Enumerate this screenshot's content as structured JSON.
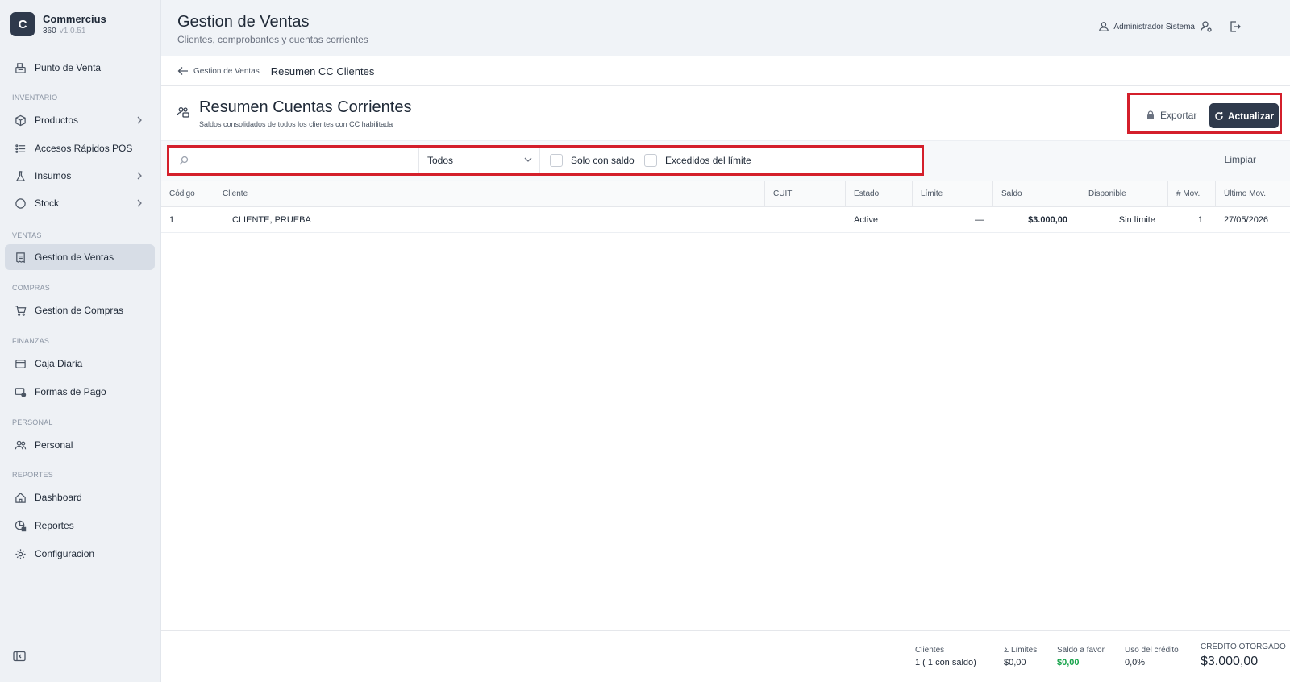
{
  "brand": {
    "logo_letter": "C",
    "name": "Commercius",
    "sub": "360",
    "version": "v1.0.51"
  },
  "sidebar": {
    "pos": "Punto de Venta",
    "sections": {
      "inventario": "INVENTARIO",
      "ventas": "VENTAS",
      "compras": "COMPRAS",
      "finanzas": "FINANZAS",
      "personal": "PERSONAL",
      "reportes": "REPORTES"
    },
    "items": {
      "productos": "Productos",
      "accesos": "Accesos Rápidos POS",
      "insumos": "Insumos",
      "stock": "Stock",
      "gestion_ventas": "Gestion de Ventas",
      "gestion_compras": "Gestion de Compras",
      "caja": "Caja Diaria",
      "formas_pago": "Formas de Pago",
      "personal": "Personal",
      "dashboard": "Dashboard",
      "reportes": "Reportes",
      "configuracion": "Configuracion"
    }
  },
  "header": {
    "title": "Gestion de Ventas",
    "subtitle": "Clientes, comprobantes y cuentas corrientes",
    "user": "Administrador Sistema"
  },
  "breadcrumb": {
    "back": "Gestion de Ventas",
    "current": "Resumen CC Clientes"
  },
  "section": {
    "title": "Resumen Cuentas Corrientes",
    "subtitle": "Saldos consolidados de todos los clientes con CC habilitada",
    "export_label": "Exportar",
    "refresh_label": "Actualizar"
  },
  "filters": {
    "search_placeholder": "",
    "status_value": "Todos",
    "only_balance_label": "Solo con saldo",
    "exceeded_label": "Excedidos del límite",
    "clear_label": "Limpiar"
  },
  "table": {
    "columns": [
      "Código",
      "Cliente",
      "CUIT",
      "Estado",
      "Límite",
      "Saldo",
      "Disponible",
      "# Mov.",
      "Último Mov."
    ],
    "rows": [
      [
        "1",
        "CLIENTE, PRUEBA",
        "",
        "Active",
        "—",
        "$3.000,00",
        "Sin límite",
        "1",
        "27/05/2026"
      ]
    ]
  },
  "footer": {
    "clientes_label": "Clientes",
    "clientes_value": "1  ( 1  con saldo)",
    "limites_label": "Σ Límites",
    "limites_value": "$0,00",
    "saldo_favor_label": "Saldo a favor",
    "saldo_favor_value": "$0,00",
    "uso_label": "Uso del crédito",
    "uso_value": "0,0%",
    "credito_label": "CRÉDITO OTORGADO",
    "credito_value": "$3.000,00"
  },
  "icons": {
    "pos": "cash-register-icon",
    "productos": "box-icon",
    "accesos": "list-icon",
    "insumos": "flask-icon",
    "stock": "circle-icon",
    "ventas": "receipt-icon",
    "compras": "cart-icon",
    "caja": "wallet-icon",
    "formas_pago": "card-icon",
    "personal": "users-icon",
    "dashboard": "home-icon",
    "reportes": "chart-icon",
    "config": "gear-icon"
  },
  "colors": {
    "primary": "#2f3a4c",
    "highlight": "#d41f2b",
    "positive": "#16a34a"
  }
}
